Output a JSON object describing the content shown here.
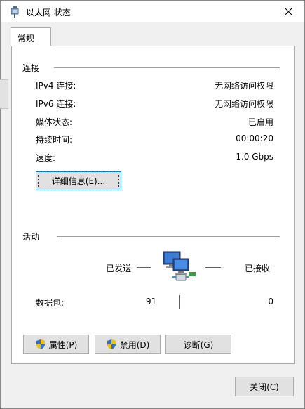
{
  "window": {
    "title": "以太网 状态"
  },
  "tabs": [
    {
      "label": "常规"
    }
  ],
  "connection": {
    "section_label": "连接",
    "rows": [
      {
        "label": "IPv4 连接:",
        "value": "无网络访问权限"
      },
      {
        "label": "IPv6 连接:",
        "value": "无网络访问权限"
      },
      {
        "label": "媒体状态:",
        "value": "已启用"
      },
      {
        "label": "持续时间:",
        "value": "00:00:20"
      },
      {
        "label": "速度:",
        "value": "1.0 Gbps"
      }
    ],
    "details_button": "详细信息(E)..."
  },
  "activity": {
    "section_label": "活动",
    "sent_label": "已发送",
    "received_label": "已接收",
    "packets_label": "数据包:",
    "packets_sent": "91",
    "packets_received": "0"
  },
  "buttons": {
    "properties": "属性(P)",
    "disable": "禁用(D)",
    "diagnose": "诊断(G)",
    "close": "关闭(C)"
  },
  "icons": {
    "window_icon": "ethernet-icon",
    "close": "close-icon",
    "shield": "uac-shield-icon",
    "activity": "network-computers-icon"
  },
  "colors": {
    "accent": "#0078d7",
    "button_face": "#e1e1e1",
    "panel_bg": "#ffffff",
    "window_bg": "#f0f0f0"
  }
}
